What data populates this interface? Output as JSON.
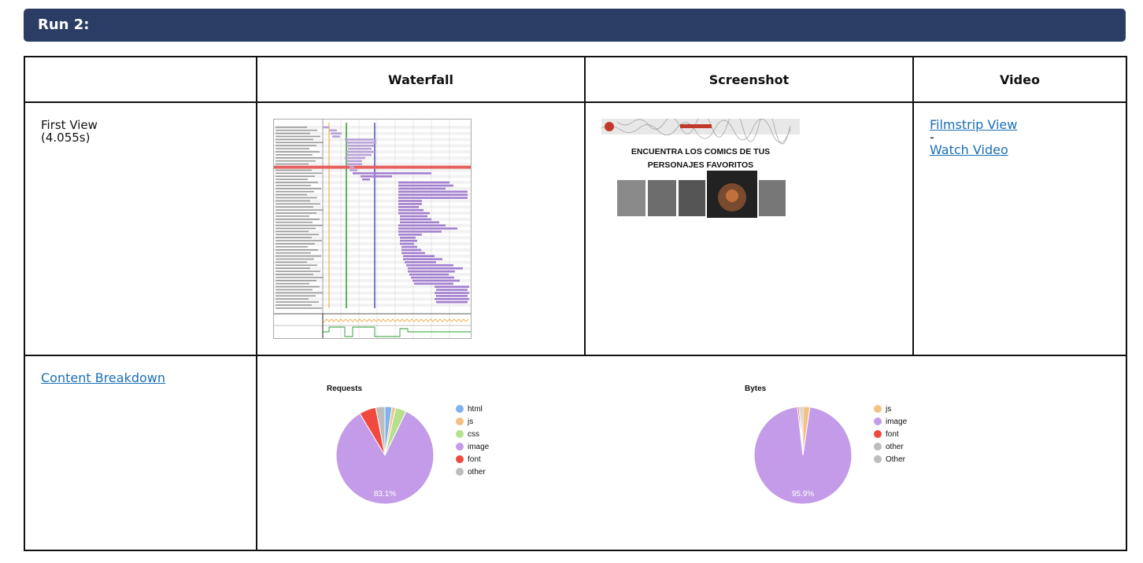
{
  "run": {
    "title": "Run 2:"
  },
  "table": {
    "headers": [
      "",
      "Waterfall",
      "Screenshot",
      "Video"
    ],
    "first_view": {
      "label": "First View",
      "time": "(4.055s)"
    },
    "video": {
      "filmstrip": "Filmstrip View",
      "separator": "-",
      "watch": "Watch Video"
    },
    "content_breakdown": "Content Breakdown"
  },
  "screenshot": {
    "headline_1": "ENCUENTRA LOS COMICS DE TUS",
    "headline_2": "PERSONAJES FAVORITOS"
  },
  "charts": {
    "requests": {
      "title": "Requests",
      "center_label": "83.1%",
      "legend": [
        {
          "name": "html",
          "color": "#7fb2ee"
        },
        {
          "name": "js",
          "color": "#f5c083"
        },
        {
          "name": "css",
          "color": "#b6e08d"
        },
        {
          "name": "image",
          "color": "#c39be8"
        },
        {
          "name": "font",
          "color": "#f0493e"
        },
        {
          "name": "other",
          "color": "#bdbdbd"
        }
      ]
    },
    "bytes": {
      "title": "Bytes",
      "center_label": "95.9%",
      "legend": [
        {
          "name": "js",
          "color": "#f5c083"
        },
        {
          "name": "image",
          "color": "#c39be8"
        },
        {
          "name": "font",
          "color": "#f0493e"
        },
        {
          "name": "other",
          "color": "#bdbdbd"
        },
        {
          "name": "Other",
          "color": "#bdbdbd"
        }
      ]
    }
  },
  "chart_data": [
    {
      "type": "pie",
      "title": "Requests",
      "categories": [
        "html",
        "js",
        "css",
        "image",
        "font",
        "other"
      ],
      "values": [
        2.3,
        1.2,
        3.6,
        83.1,
        5.5,
        3.0
      ],
      "legend": "right"
    },
    {
      "type": "pie",
      "title": "Bytes",
      "categories": [
        "js",
        "image",
        "font",
        "other",
        "Other"
      ],
      "values": [
        2.3,
        95.9,
        0.5,
        0.6,
        0.7
      ],
      "legend": "right"
    }
  ]
}
